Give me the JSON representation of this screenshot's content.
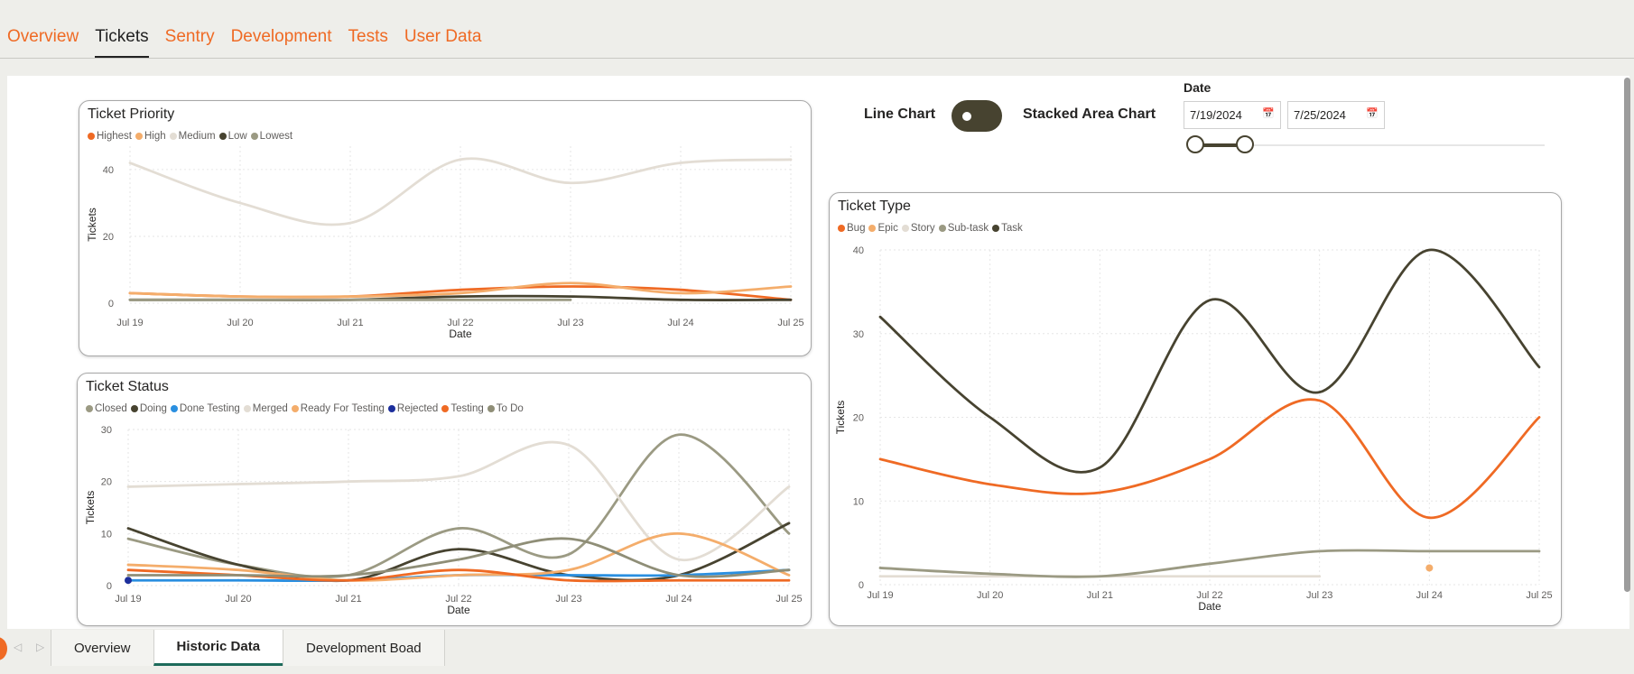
{
  "top_tabs": [
    "Overview",
    "Tickets",
    "Sentry",
    "Development",
    "Tests",
    "User Data"
  ],
  "active_top_tab": "Tickets",
  "toggle": {
    "left_label": "Line Chart",
    "right_label": "Stacked Area Chart",
    "state": "Line Chart"
  },
  "date_filter": {
    "title": "Date",
    "start": "7/19/2024",
    "end": "7/25/2024",
    "icon": "calendar-icon"
  },
  "bottom_tabs": [
    "Overview",
    "Historic Data",
    "Development Boad"
  ],
  "active_bottom_tab": "Historic Data",
  "colors": {
    "accent": "#ef6a24",
    "dark": "#474330"
  },
  "chart_data": [
    {
      "id": "priority",
      "type": "line",
      "title": "Ticket Priority",
      "xlabel": "Date",
      "ylabel": "Tickets",
      "x": [
        "Jul 19",
        "Jul 20",
        "Jul 21",
        "Jul 22",
        "Jul 23",
        "Jul 24",
        "Jul 25"
      ],
      "yticks": [
        0,
        20,
        40
      ],
      "ylim": [
        0,
        47
      ],
      "series": [
        {
          "name": "Highest",
          "color": "#ef6a24",
          "values": [
            3,
            2,
            2,
            4,
            5,
            4,
            1
          ]
        },
        {
          "name": "High",
          "color": "#f4ad6b",
          "values": [
            3,
            2,
            2,
            3,
            6,
            3,
            5
          ]
        },
        {
          "name": "Medium",
          "color": "#e3ddd4",
          "values": [
            42,
            30,
            24,
            43,
            36,
            42,
            43
          ]
        },
        {
          "name": "Low",
          "color": "#474330",
          "values": [
            1,
            1,
            1,
            2,
            2,
            1,
            1
          ]
        },
        {
          "name": "Lowest",
          "color": "#9b9a83",
          "values": [
            1,
            1,
            1,
            1,
            1,
            null,
            null
          ]
        }
      ]
    },
    {
      "id": "status",
      "type": "line",
      "title": "Ticket Status",
      "xlabel": "Date",
      "ylabel": "Tickets",
      "x": [
        "Jul 19",
        "Jul 20",
        "Jul 21",
        "Jul 22",
        "Jul 23",
        "Jul 24",
        "Jul 25"
      ],
      "yticks": [
        0,
        10,
        20,
        30
      ],
      "ylim": [
        0,
        30
      ],
      "series": [
        {
          "name": "Closed",
          "color": "#9b9a83",
          "values": [
            9,
            4,
            2,
            11,
            6,
            29,
            10
          ]
        },
        {
          "name": "Doing",
          "color": "#474330",
          "values": [
            11,
            4,
            1,
            7,
            2,
            2,
            12
          ]
        },
        {
          "name": "Done Testing",
          "color": "#2a8fe0",
          "values": [
            1,
            1,
            1,
            2,
            2,
            2,
            3
          ]
        },
        {
          "name": "Merged",
          "color": "#e3ddd4",
          "values": [
            19,
            19.5,
            20,
            21,
            27,
            5,
            19
          ]
        },
        {
          "name": "Ready For Testing",
          "color": "#f4ad6b",
          "values": [
            4,
            3,
            1,
            2,
            3,
            10,
            2
          ]
        },
        {
          "name": "Rejected",
          "color": "#1c2e9c",
          "values": [
            1,
            null,
            null,
            null,
            null,
            null,
            null
          ]
        },
        {
          "name": "Testing",
          "color": "#ef6a24",
          "values": [
            3,
            2,
            1,
            3,
            1,
            1,
            1
          ]
        },
        {
          "name": "To Do",
          "color": "#8f8e77",
          "values": [
            2,
            2,
            2,
            5,
            9,
            2,
            3
          ]
        }
      ]
    },
    {
      "id": "type",
      "type": "line",
      "title": "Ticket Type",
      "xlabel": "Date",
      "ylabel": "Tickets",
      "x": [
        "Jul 19",
        "Jul 20",
        "Jul 21",
        "Jul 22",
        "Jul 23",
        "Jul 24",
        "Jul 25"
      ],
      "yticks": [
        0,
        10,
        20,
        30,
        40
      ],
      "ylim": [
        0,
        40
      ],
      "series": [
        {
          "name": "Bug",
          "color": "#ef6a24",
          "values": [
            15,
            12,
            11,
            15,
            22,
            8,
            20
          ]
        },
        {
          "name": "Epic",
          "color": "#f4ad6b",
          "values": [
            null,
            null,
            null,
            null,
            null,
            2,
            null
          ]
        },
        {
          "name": "Story",
          "color": "#e3ddd4",
          "values": [
            1,
            1,
            1,
            1,
            1,
            null,
            null
          ]
        },
        {
          "name": "Sub-task",
          "color": "#9b9a83",
          "values": [
            2,
            1.3,
            1,
            2.5,
            4,
            4,
            4
          ]
        },
        {
          "name": "Task",
          "color": "#474330",
          "values": [
            32,
            20,
            14,
            34,
            23,
            40,
            26
          ]
        }
      ]
    }
  ]
}
